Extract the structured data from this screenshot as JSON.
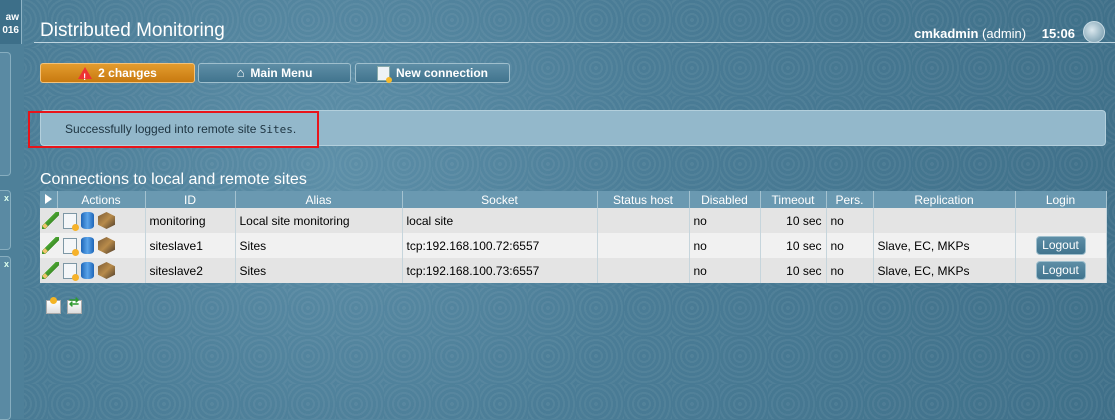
{
  "sidebar": {
    "top_text_line1": "aw",
    "top_text_line2": "016",
    "panel_close_1": "x",
    "panel_close_2": "x"
  },
  "header": {
    "title": "Distributed Monitoring",
    "user": "cmkadmin",
    "role": "(admin)",
    "time": "15:06"
  },
  "toolbar": {
    "changes_label": "2 changes",
    "main_menu_label": "Main Menu",
    "new_connection_label": "New connection"
  },
  "message": {
    "text_prefix": "Successfully logged into remote site ",
    "site": "Sites",
    "text_suffix": "."
  },
  "table": {
    "title": "Connections to local and remote sites",
    "columns": [
      "",
      "Actions",
      "ID",
      "Alias",
      "Socket",
      "Status host",
      "Disabled",
      "Timeout",
      "Pers.",
      "Replication",
      "Login"
    ],
    "rows": [
      {
        "id": "monitoring",
        "alias": "Local site monitoring",
        "socket": "local site",
        "status_host": "",
        "disabled": "no",
        "timeout": "10 sec",
        "persist": "no",
        "replication": "",
        "login": ""
      },
      {
        "id": "siteslave1",
        "alias": "Sites",
        "socket": "tcp:192.168.100.72:6557",
        "status_host": "",
        "disabled": "no",
        "timeout": "10 sec",
        "persist": "no",
        "replication": "Slave, EC, MKPs",
        "login": "Logout"
      },
      {
        "id": "siteslave2",
        "alias": "Sites",
        "socket": "tcp:192.168.100.73:6557",
        "status_host": "",
        "disabled": "no",
        "timeout": "10 sec",
        "persist": "no",
        "replication": "Slave, EC, MKPs",
        "login": "Logout"
      }
    ]
  },
  "colors": {
    "accent_orange": "#c87a10",
    "highlight_red": "#e8141a",
    "message_bg": "#93b8cb"
  },
  "icons": [
    "warning-icon",
    "home-icon",
    "new-document-icon",
    "edit-icon",
    "clone-icon",
    "database-icon",
    "site-cube-icon",
    "new-site-icon",
    "migrate-icon",
    "globe-icon"
  ]
}
